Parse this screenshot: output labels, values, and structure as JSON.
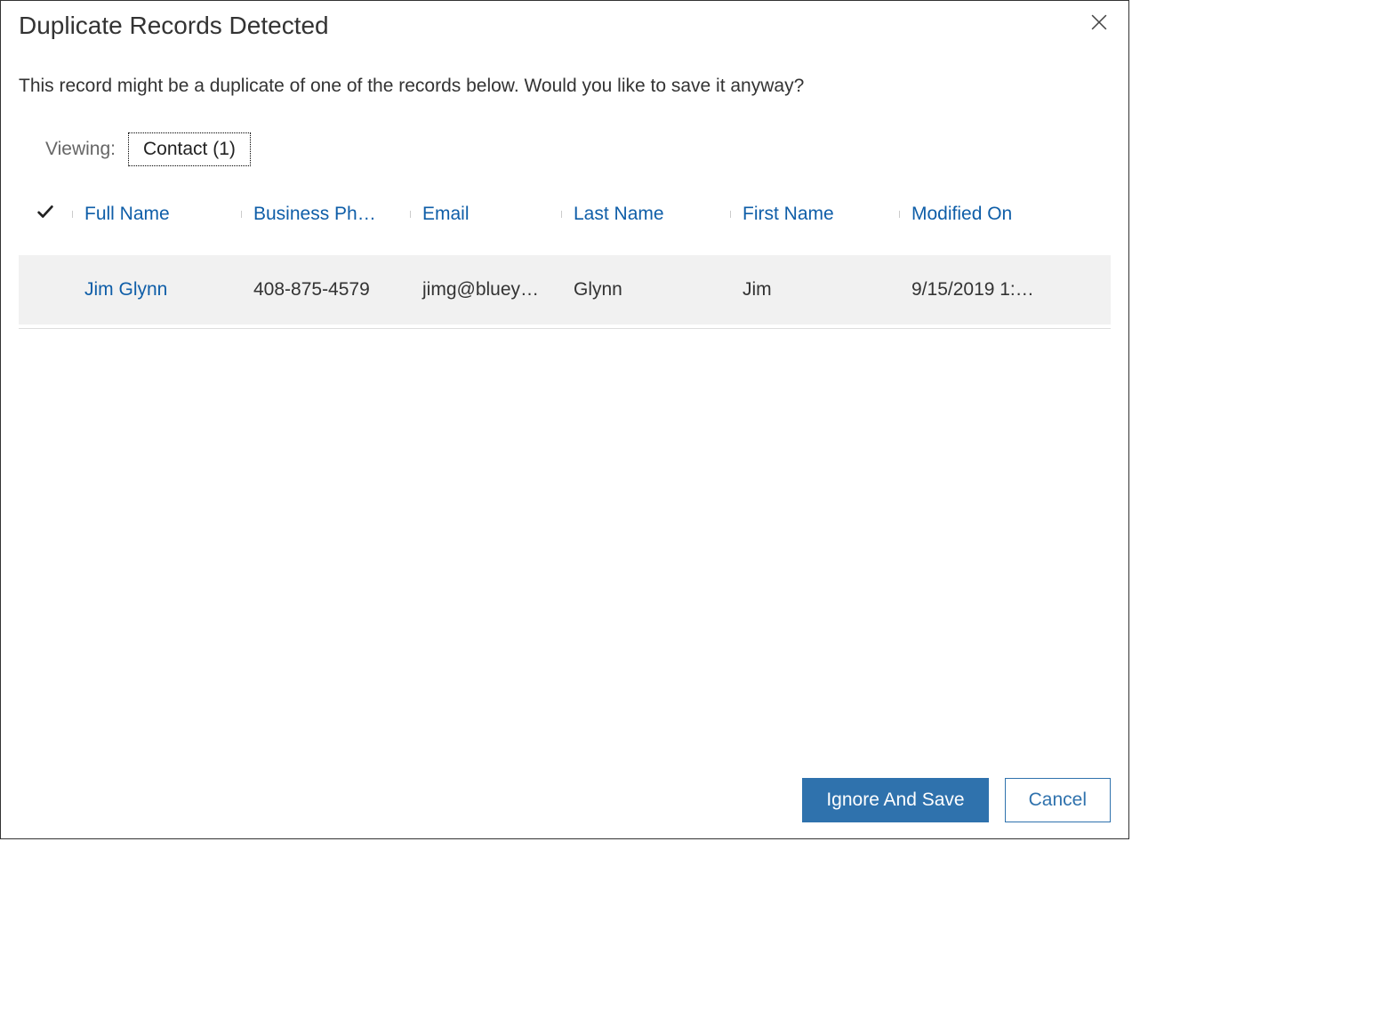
{
  "dialog": {
    "title": "Duplicate Records Detected",
    "message": "This record might be a duplicate of one of the records below. Would you like to save it anyway?"
  },
  "viewing": {
    "label": "Viewing:",
    "chip": "Contact (1)"
  },
  "grid": {
    "columns": {
      "full_name": "Full Name",
      "business_phone": "Business Ph…",
      "email": "Email",
      "last_name": "Last Name",
      "first_name": "First Name",
      "modified_on": "Modified On"
    },
    "rows": [
      {
        "full_name": "Jim Glynn",
        "business_phone": "408-875-4579",
        "email": "jimg@bluey…",
        "last_name": "Glynn",
        "first_name": "Jim",
        "modified_on": "9/15/2019 1:…"
      }
    ]
  },
  "footer": {
    "primary": "Ignore And Save",
    "secondary": "Cancel"
  }
}
